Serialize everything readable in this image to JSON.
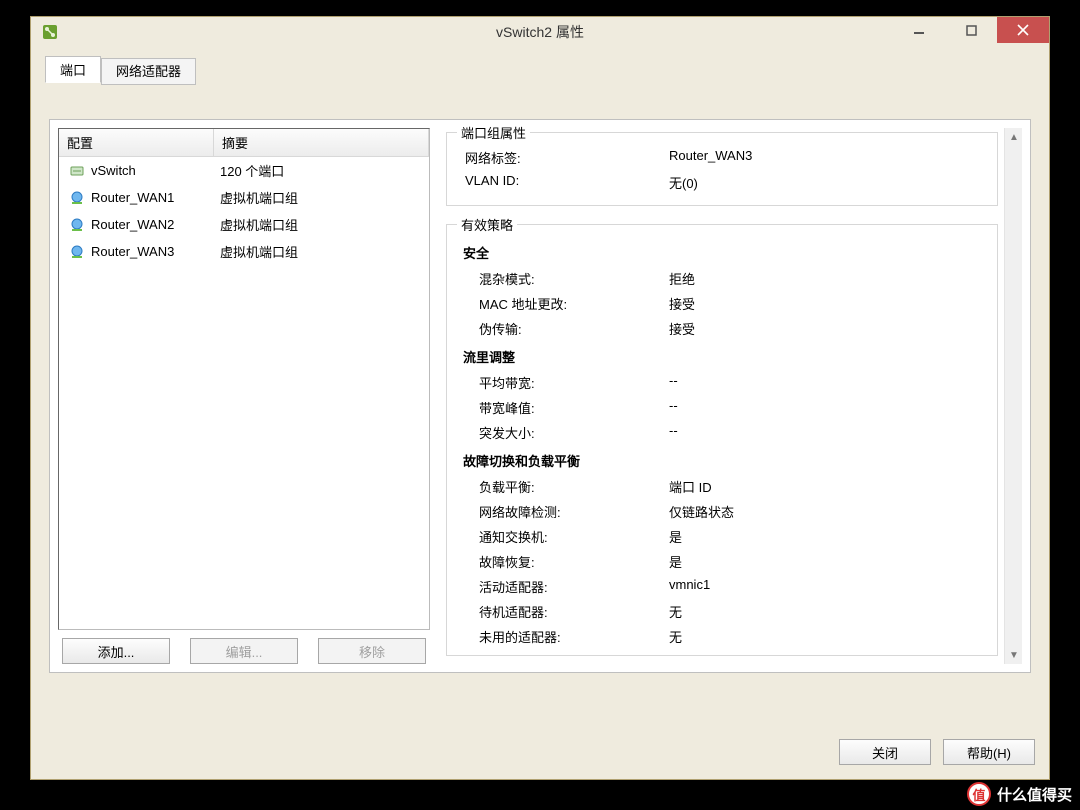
{
  "window": {
    "title": "vSwitch2 属性"
  },
  "tabs": {
    "ports": "端口",
    "adapters": "网络适配器"
  },
  "list": {
    "headers": {
      "config": "配置",
      "summary": "摘要"
    },
    "rows": [
      {
        "icon": "vswitch",
        "name": "vSwitch",
        "summary": "120 个端口"
      },
      {
        "icon": "portgroup",
        "name": "Router_WAN1",
        "summary": "虚拟机端口组"
      },
      {
        "icon": "portgroup",
        "name": "Router_WAN2",
        "summary": "虚拟机端口组"
      },
      {
        "icon": "portgroup",
        "name": "Router_WAN3",
        "summary": "虚拟机端口组"
      }
    ],
    "buttons": {
      "add": "添加...",
      "edit": "编辑...",
      "remove": "移除"
    }
  },
  "props": {
    "group_legend": "端口组属性",
    "label_net": "网络标签:",
    "value_net": "Router_WAN3",
    "label_vlan": "VLAN ID:",
    "value_vlan": "无(0)"
  },
  "policy": {
    "legend": "有效策略",
    "security": {
      "heading": "安全",
      "promisc_k": "混杂模式:",
      "promisc_v": "拒绝",
      "mac_k": "MAC 地址更改:",
      "mac_v": "接受",
      "forged_k": "伪传输:",
      "forged_v": "接受"
    },
    "traffic": {
      "heading": "流里调整",
      "avg_k": "平均带宽:",
      "avg_v": "--",
      "peak_k": "带宽峰值:",
      "peak_v": "--",
      "burst_k": "突发大小:",
      "burst_v": "--"
    },
    "failover": {
      "heading": "故障切换和负载平衡",
      "lb_k": "负载平衡:",
      "lb_v": "端口 ID",
      "detect_k": "网络故障检测:",
      "detect_v": "仅链路状态",
      "notify_k": "通知交换机:",
      "notify_v": "是",
      "failback_k": "故障恢复:",
      "failback_v": "是",
      "active_k": "活动适配器:",
      "active_v": "vmnic1",
      "standby_k": "待机适配器:",
      "standby_v": "无",
      "unused_k": "未用的适配器:",
      "unused_v": "无"
    }
  },
  "footer": {
    "close": "关闭",
    "help": "帮助(H)"
  },
  "watermark": {
    "badge": "值",
    "text": "什么值得买"
  }
}
